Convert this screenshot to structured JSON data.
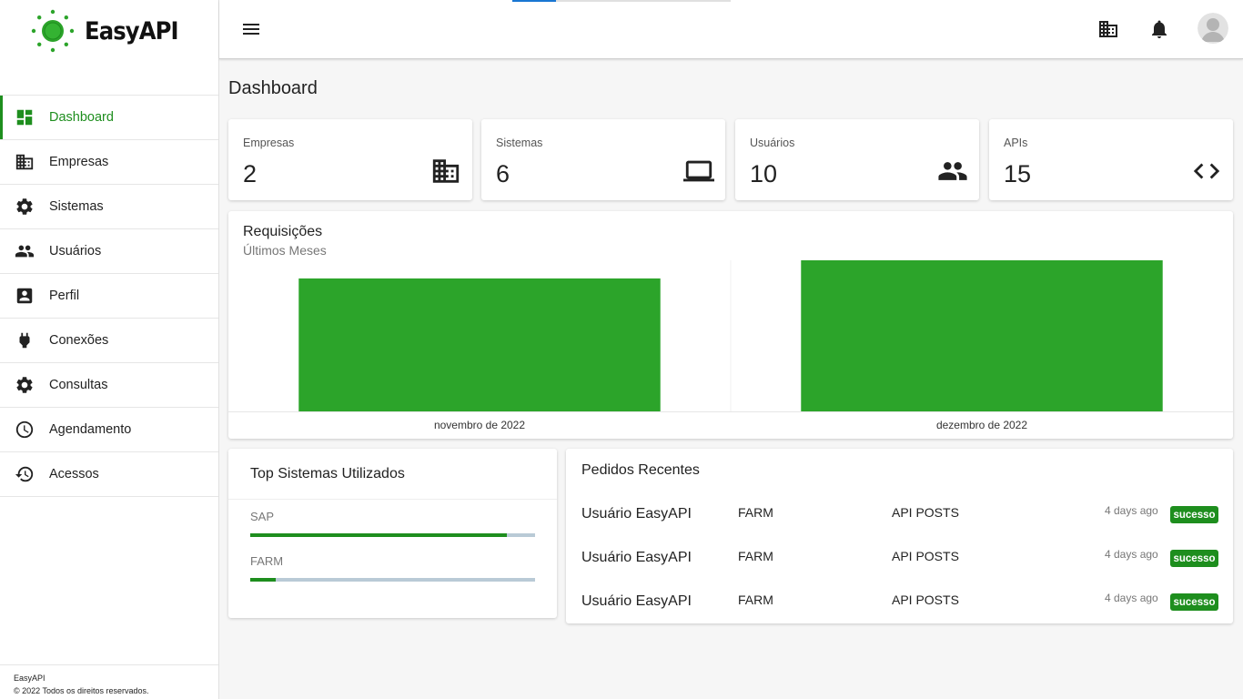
{
  "app": {
    "name": "EasyAPI",
    "brand_color": "#1e8e1e"
  },
  "sidebar": {
    "items": [
      {
        "label": "Dashboard",
        "icon": "dashboard-icon",
        "active": true
      },
      {
        "label": "Empresas",
        "icon": "business-icon"
      },
      {
        "label": "Sistemas",
        "icon": "gear-icon"
      },
      {
        "label": "Usuários",
        "icon": "people-icon"
      },
      {
        "label": "Perfil",
        "icon": "account-box-icon"
      },
      {
        "label": "Conexões",
        "icon": "plug-icon"
      },
      {
        "label": "Consultas",
        "icon": "gear-icon"
      },
      {
        "label": "Agendamento",
        "icon": "clock-icon"
      },
      {
        "label": "Acessos",
        "icon": "history-icon"
      }
    ],
    "footer": {
      "line1": "EasyAPI",
      "line2": "© 2022 Todos os direitos reservados."
    }
  },
  "topbar": {
    "icons": [
      "menu-icon",
      "business-icon",
      "bell-icon",
      "avatar"
    ]
  },
  "page": {
    "title": "Dashboard"
  },
  "stats": [
    {
      "label": "Empresas",
      "value": "2",
      "icon": "business-icon"
    },
    {
      "label": "Sistemas",
      "value": "6",
      "icon": "laptop-icon"
    },
    {
      "label": "Usuários",
      "value": "10",
      "icon": "people-icon"
    },
    {
      "label": "APIs",
      "value": "15",
      "icon": "code-icon"
    }
  ],
  "requests_chart": {
    "title": "Requisições",
    "subtitle": "Últimos Meses"
  },
  "chart_data": {
    "type": "bar",
    "categories": [
      "novembro de 2022",
      "dezembro de 2022"
    ],
    "values": [
      88,
      100
    ],
    "ylim": [
      0,
      100
    ],
    "bar_color": "#2ca42a",
    "grid": false,
    "legend": "none"
  },
  "top_systems": {
    "title": "Top Sistemas Utilizados",
    "items": [
      {
        "label": "SAP",
        "fraction": 0.9
      },
      {
        "label": "FARM",
        "fraction": 0.09
      }
    ]
  },
  "recent_orders": {
    "title": "Pedidos Recentes",
    "rows": [
      {
        "user": "Usuário EasyAPI",
        "system": "FARM",
        "api": "API POSTS",
        "time": "4 days ago",
        "status": "sucesso"
      },
      {
        "user": "Usuário EasyAPI",
        "system": "FARM",
        "api": "API POSTS",
        "time": "4 days ago",
        "status": "sucesso"
      },
      {
        "user": "Usuário EasyAPI",
        "system": "FARM",
        "api": "API POSTS",
        "time": "4 days ago",
        "status": "sucesso"
      }
    ]
  }
}
